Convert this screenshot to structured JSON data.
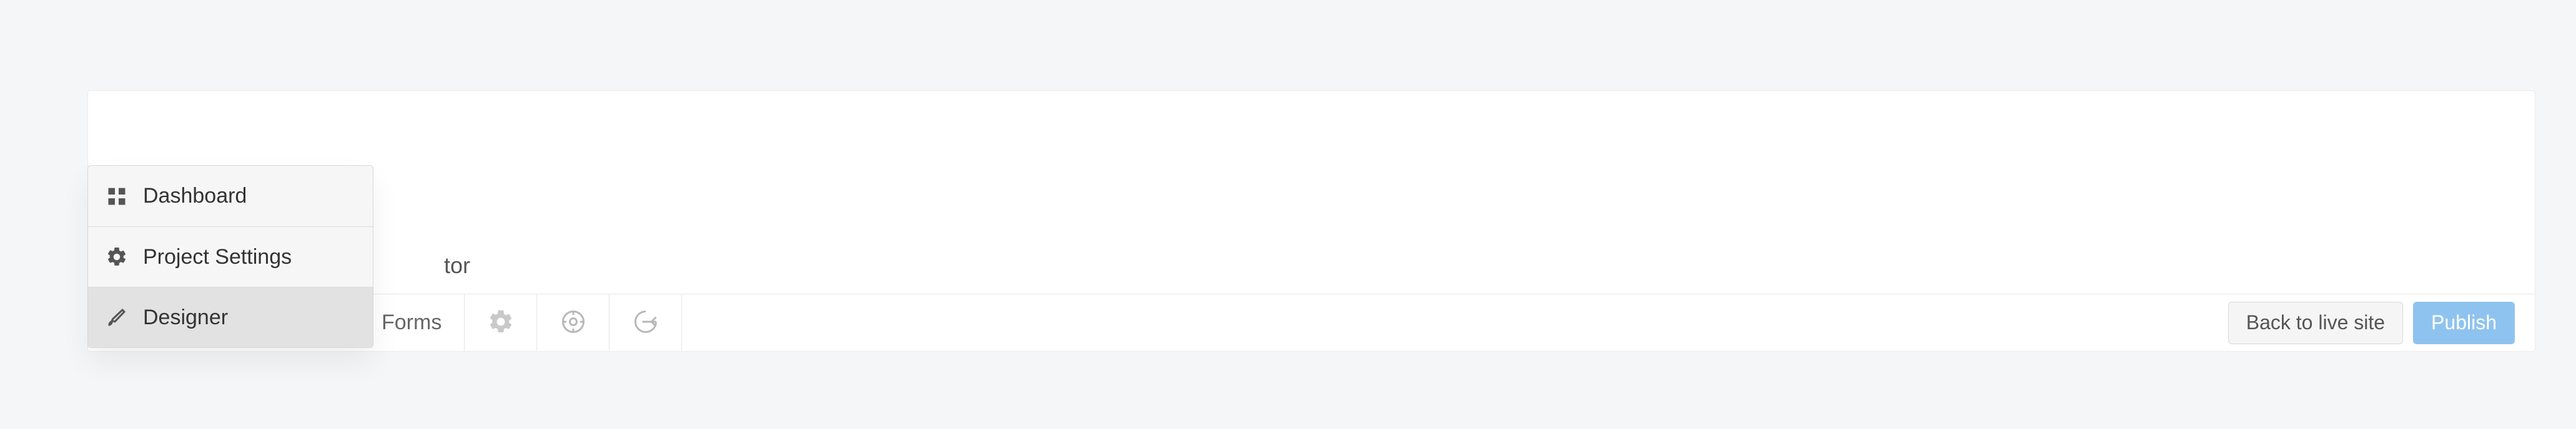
{
  "header_peek": "tor",
  "tabs": {
    "forms_label": "Forms"
  },
  "buttons": {
    "back_label": "Back to live site",
    "publish_label": "Publish"
  },
  "dropdown": {
    "items": [
      {
        "label": "Dashboard"
      },
      {
        "label": "Project Settings"
      },
      {
        "label": "Designer"
      }
    ]
  }
}
